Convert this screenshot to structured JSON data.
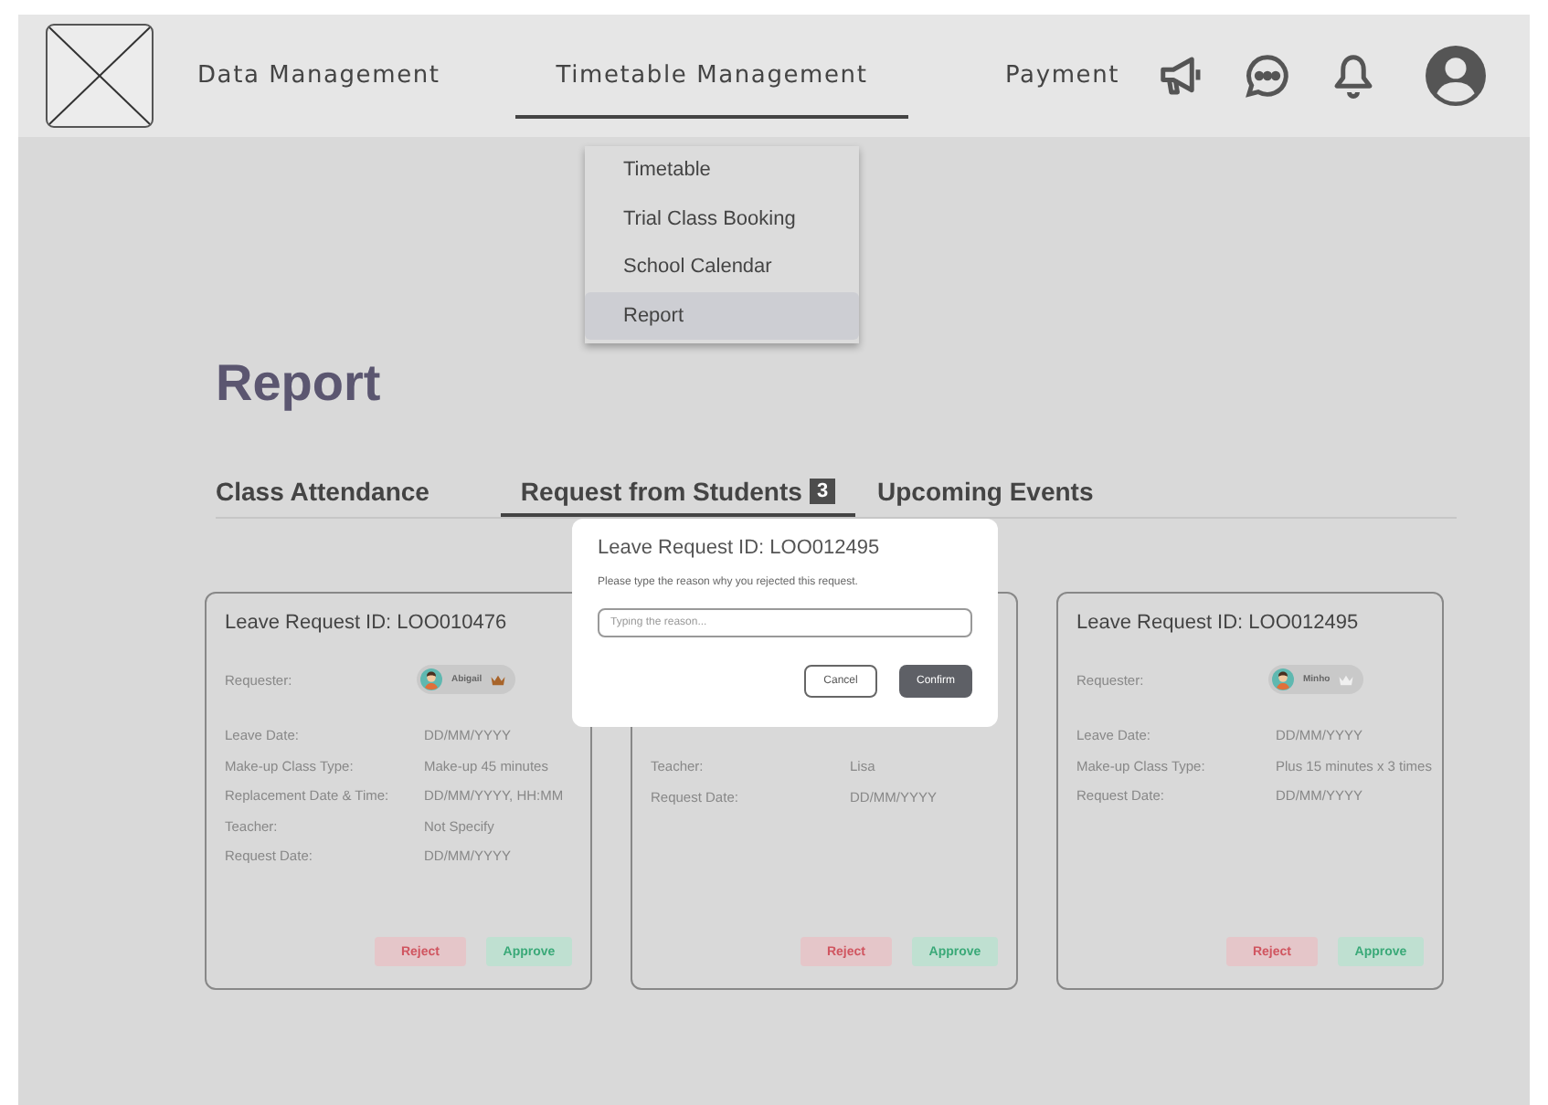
{
  "nav": {
    "items": [
      {
        "label": "Data Management",
        "selected": false
      },
      {
        "label": "Timetable Management",
        "selected": true
      },
      {
        "label": "Payment",
        "selected": false
      }
    ]
  },
  "dropdown": {
    "items": [
      {
        "label": "Timetable",
        "selected": false
      },
      {
        "label": "Trial Class Booking",
        "selected": false
      },
      {
        "label": "School Calendar",
        "selected": false
      },
      {
        "label": "Report",
        "selected": true
      }
    ]
  },
  "page_title": "Report",
  "tabs": [
    {
      "label": "Class Attendance",
      "selected": false
    },
    {
      "label": "Request from Students",
      "selected": true,
      "badge": "3"
    },
    {
      "label": "Upcoming Events",
      "selected": false
    }
  ],
  "cards": [
    {
      "title": "Leave Request ID: LOO010476",
      "requester": {
        "label": "Requester:",
        "name": "Abigail",
        "crowned": true
      },
      "rows": [
        {
          "label": "Leave Date:",
          "value": "DD/MM/YYYY"
        },
        {
          "label": "Make-up Class Type:",
          "value": "Make-up 45 minutes"
        },
        {
          "label": "Replacement Date & Time:",
          "value": "DD/MM/YYYY, HH:MM"
        },
        {
          "label": "Teacher:",
          "value": "Not Specify"
        },
        {
          "label": "Request Date:",
          "value": "DD/MM/YYYY"
        }
      ],
      "buttons": [
        "Reject",
        "Approve"
      ]
    },
    {
      "rows": [
        {
          "label": "Teacher:",
          "value": "Lisa"
        },
        {
          "label": "Request Date:",
          "value": "DD/MM/YYYY"
        }
      ],
      "buttons": [
        "Reject",
        "Approve"
      ]
    },
    {
      "title": "Leave Request ID: LOO012495",
      "requester": {
        "label": "Requester:",
        "name": "Minho",
        "crowned": false
      },
      "rows": [
        {
          "label": "Leave Date:",
          "value": "DD/MM/YYYY"
        },
        {
          "label": "Make-up Class Type:",
          "value": "Plus 15 minutes x 3 times"
        },
        {
          "label": "Request Date:",
          "value": "DD/MM/YYYY"
        }
      ],
      "buttons": [
        "Reject",
        "Approve"
      ]
    }
  ],
  "modal": {
    "title": "Leave Request ID: LOO012495",
    "message": "Please type the reason why you rejected this request.",
    "input": {
      "placeholder": "Typing the reason..."
    },
    "buttons": [
      {
        "label": "Cancel",
        "kind": "secondary"
      },
      {
        "label": "Confirm",
        "kind": "primary"
      }
    ]
  }
}
